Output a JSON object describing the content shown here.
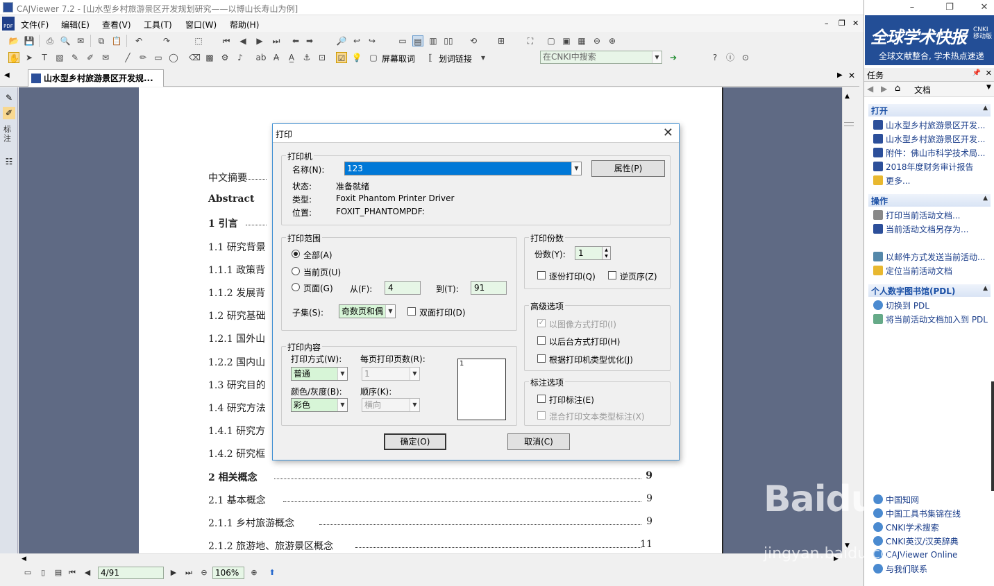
{
  "window": {
    "title": "CAJViewer 7.2 - [山水型乡村旅游景区开发规划研究——以博山长寿山为例]"
  },
  "menu": {
    "items": [
      "文件(F)",
      "编辑(E)",
      "查看(V)",
      "工具(T)",
      "窗口(W)",
      "帮助(H)"
    ]
  },
  "toolbar": {
    "select_text_label": "屏幕取词",
    "word_link_label": "划词链接",
    "search_placeholder": "在CNKI中搜索"
  },
  "tab": {
    "label": "山水型乡村旅游景区开发规..."
  },
  "left_tool": {
    "label": "标注"
  },
  "toc": [
    {
      "text": "中文摘要",
      "page": "",
      "bold": false
    },
    {
      "text": "Abstract",
      "page": "",
      "bold": true
    },
    {
      "text": "1 引言",
      "page": "",
      "bold": true
    },
    {
      "text": "1.1 研究背景",
      "page": "",
      "bold": false
    },
    {
      "text": "1.1.1 政策背",
      "page": "",
      "bold": false
    },
    {
      "text": "1.1.2 发展背",
      "page": "",
      "bold": false
    },
    {
      "text": "1.2 研究基础",
      "page": "",
      "bold": false
    },
    {
      "text": "1.2.1 国外山",
      "page": "",
      "bold": false
    },
    {
      "text": "1.2.2 国内山",
      "page": "",
      "bold": false
    },
    {
      "text": "1.3 研究目的",
      "page": "",
      "bold": false
    },
    {
      "text": "1.4 研究方法",
      "page": "",
      "bold": false
    },
    {
      "text": "1.4.1 研究方",
      "page": "",
      "bold": false
    },
    {
      "text": "1.4.2 研究框",
      "page": "",
      "bold": false
    },
    {
      "text": "2  相关概念",
      "page": "9",
      "bold": true
    },
    {
      "text": "2.1 基本概念",
      "page": "9",
      "bold": false
    },
    {
      "text": "2.1.1 乡村旅游概念",
      "page": "9",
      "bold": false
    },
    {
      "text": "2.1.2 旅游地、旅游景区概念",
      "page": "11",
      "bold": false
    }
  ],
  "status": {
    "page": "4/91",
    "zoom": "106%"
  },
  "right_panel": {
    "banner_title": "全球学术快报",
    "banner_tag": "CNKI 移动版",
    "banner_sub": "全球文献整合, 学术热点速递",
    "task_header": "任务",
    "nav_label": "文档",
    "sections": {
      "open": "打开",
      "ops": "操作",
      "pdl": "个人数字图书馆(PDL)"
    },
    "open_items": [
      "山水型乡村旅游景区开发...",
      "山水型乡村旅游景区开发...",
      "附件：佛山市科学技术局...",
      "2018年度财务审计报告",
      "更多..."
    ],
    "op_items": [
      "打印当前活动文档...",
      "当前活动文档另存为...",
      "以邮件方式发送当前活动...",
      "定位当前活动文档"
    ],
    "pdl_items": [
      "切换到 PDL",
      "将当前活动文档加入到 PDL"
    ],
    "links": [
      "中国知网",
      "中国工具书集锦在线",
      "CNKI学术搜索",
      "CNKI英汉/汉英辞典",
      "CAJViewer Online",
      "与我们联系"
    ]
  },
  "dialog": {
    "title": "打印",
    "printer_group": "打印机",
    "name_label": "名称(N):",
    "name_value": "123",
    "properties_button": "属性(P)",
    "status_label": "状态:",
    "status_value": "准备就绪",
    "type_label": "类型:",
    "type_value": "Foxit Phantom Printer Driver",
    "location_label": "位置:",
    "location_value": "FOXIT_PHANTOMPDF:",
    "range_group": "打印范围",
    "range_all": "全部(A)",
    "range_current": "当前页(U)",
    "range_pages": "页面(G)",
    "from_label": "从(F):",
    "from_value": "4",
    "to_label": "到(T):",
    "to_value": "91",
    "subset_label": "子集(S):",
    "subset_value": "奇数页和偶",
    "duplex_label": "双面打印(D)",
    "copies_group": "打印份数",
    "copies_label": "份数(Y):",
    "copies_value": "1",
    "collate_label": "逐份打印(Q)",
    "reverse_label": "逆页序(Z)",
    "advanced_group": "高级选项",
    "as_image_label": "以图像方式打印(I)",
    "background_label": "以后台方式打印(H)",
    "optimize_label": "根据打印机类型优化(J)",
    "content_group": "打印内容",
    "mode_label": "打印方式(W):",
    "mode_value": "普通",
    "per_page_label": "每页打印页数(R):",
    "per_page_value": "1",
    "color_label": "颜色/灰度(B):",
    "color_value": "彩色",
    "order_label": "顺序(K):",
    "order_value": "横向",
    "preview_text": "1",
    "annot_group": "标注选项",
    "print_annot_label": "打印标注(E)",
    "mixed_label": "混合打印文本类型标注(X)",
    "ok_button": "确定(O)",
    "cancel_button": "取消(C)"
  },
  "watermark": {
    "brand": "Baidu",
    "sub": "jingyan.baidu.com"
  }
}
